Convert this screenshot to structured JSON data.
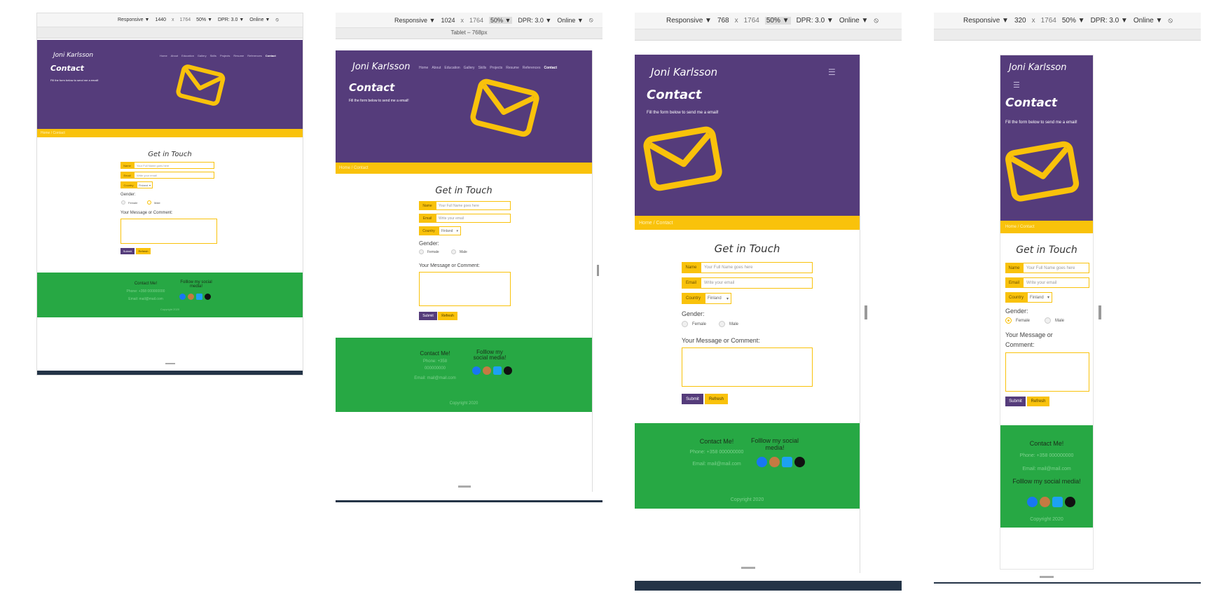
{
  "toolbar": {
    "responsive": "Responsive ▼",
    "times": "x",
    "zoom": "50% ▼",
    "dpr": "DPR: 3.0 ▼",
    "online": "Online ▼",
    "rotate_icon": "rotate-icon"
  },
  "panels": [
    {
      "width": "1440",
      "height": "1764"
    },
    {
      "width": "1024",
      "height": "1764",
      "ruler_label": "Tablet – 768px"
    },
    {
      "width": "768",
      "height": "1764"
    },
    {
      "width": "320",
      "height": "1764"
    }
  ],
  "site": {
    "brand": "Joni Karlsson",
    "nav": [
      "Home",
      "About",
      "Education",
      "Gallery",
      "Skills",
      "Projects",
      "Resume",
      "References",
      "Contact"
    ],
    "nav_tablet": [
      "Home",
      "About",
      "Education",
      "Gallery",
      "Skills",
      "Projects",
      "Resume",
      "References",
      "Contact"
    ],
    "burger": "☰",
    "title": "Contact",
    "subtitle": "Fill the form below to send me a email!",
    "breadcrumb": "Home / Contact",
    "form": {
      "heading": "Get in Touch",
      "name_label": "Name",
      "name_placeholder": "Your Full Name goes here",
      "email_label": "Email",
      "email_placeholder": "Write your email",
      "country_label": "Country",
      "country_value": "Finland",
      "gender_label": "Gender:",
      "female": "Female",
      "male": "Male",
      "message_label": "Your Message or Comment:",
      "submit": "Submit",
      "refresh": "Refresh"
    },
    "footer": {
      "contact_heading": "Contact Me!",
      "phone": "Phone: +358 000000000",
      "email": "Email: mail@mail.com",
      "follow_heading": "Folllow my social media!",
      "copyright": "Copyright 2020"
    }
  },
  "colors": {
    "purple": "#553c7b",
    "yellow": "#f9c20b",
    "green": "#27a844"
  },
  "icons": [
    "envelope-icon",
    "facebook-icon",
    "instagram-icon",
    "twitter-icon",
    "github-icon",
    "menu-icon",
    "rotate-icon"
  ]
}
